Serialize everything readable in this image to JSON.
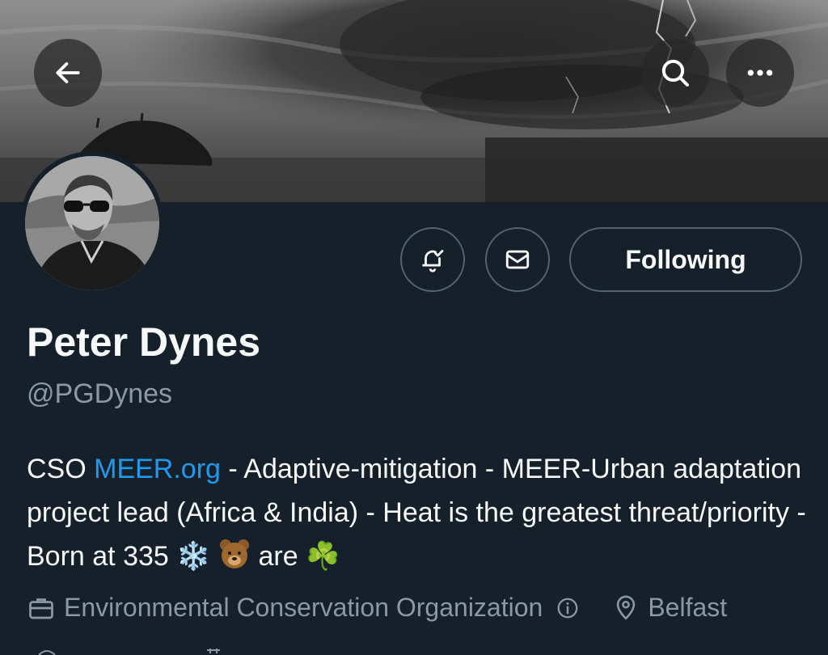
{
  "header": {
    "back_icon": "arrow-left-icon",
    "search_icon": "search-icon",
    "more_icon": "more-horizontal-icon"
  },
  "profile": {
    "name": "Peter Dynes",
    "handle": "@PGDynes",
    "bio": {
      "prefix": "CSO ",
      "link": "MEER.org",
      "text_after_link": " - Adaptive-mitigation - MEER-Urban adaptation project lead (Africa & India) - Heat is the greatest threat/priority -Born at 335 ",
      "emoji_1": "❄️",
      "emoji_2": "🐻",
      "word": " are ",
      "emoji_3": "☘️"
    },
    "category": "Environmental Conservation Organization",
    "location": "Belfast"
  },
  "actions": {
    "notify_icon": "bell-check-icon",
    "message_icon": "mail-icon",
    "following_label": "Following"
  },
  "colors": {
    "background": "#15202b",
    "accent": "#1d9bf0",
    "secondary_text": "#8b98a5",
    "border": "#536471"
  }
}
